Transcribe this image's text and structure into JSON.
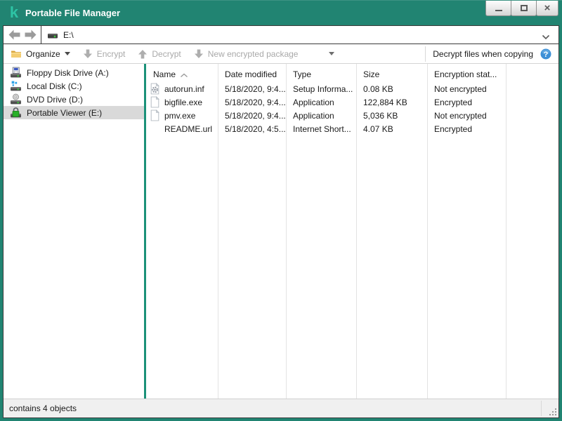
{
  "window": {
    "title": "Portable File Manager",
    "logo_glyph": "k",
    "controls": {
      "minimize": "minimize",
      "maximize": "maximize",
      "close_glyph": "×"
    }
  },
  "colors": {
    "titlebar": "#218472",
    "logo_green": "#2ec4a5",
    "pane_separator": "#1b9179",
    "selection_gray": "#d9d9d9",
    "help_blue": "#3d8fd6",
    "disabled_text": "#a9a9a9"
  },
  "nav": {
    "address": "E:\\",
    "drive_icon": "drive-small-icon",
    "back_icon": "nav-back-icon",
    "forward_icon": "nav-forward-icon"
  },
  "toolbar": {
    "items": [
      {
        "label": "Organize",
        "icon": "folder-icon",
        "enabled": true,
        "has_dropdown": true
      },
      {
        "label": "Encrypt",
        "icon": "arrow-down-icon",
        "enabled": false,
        "has_dropdown": false
      },
      {
        "label": "Decrypt",
        "icon": "arrow-up-icon",
        "enabled": false,
        "has_dropdown": false
      },
      {
        "label": "New encrypted package",
        "icon": "arrow-down-icon",
        "enabled": false,
        "has_dropdown": true
      }
    ],
    "right_label": "Decrypt files when copying",
    "help_icon": "help-icon"
  },
  "sidebar": {
    "items": [
      {
        "label": "Floppy Disk Drive (A:)",
        "icon": "floppy-drive-icon",
        "selected": false
      },
      {
        "label": "Local Disk (C:)",
        "icon": "local-disk-icon",
        "selected": false
      },
      {
        "label": "DVD Drive (D:)",
        "icon": "dvd-drive-icon",
        "selected": false
      },
      {
        "label": "Portable Viewer (E:)",
        "icon": "locked-drive-icon",
        "selected": true
      }
    ]
  },
  "filelist": {
    "columns": [
      "Name",
      "Date modified",
      "Type",
      "Size",
      "Encryption stat..."
    ],
    "sorted_by": "Name",
    "sort_direction": "ascending",
    "rows": [
      {
        "name": "autorun.inf",
        "date": "5/18/2020, 9:4...",
        "type": "Setup Informa...",
        "size": "0.08 KB",
        "status": "Not encrypted",
        "icon": "setup-file-icon"
      },
      {
        "name": "bigfile.exe",
        "date": "5/18/2020, 9:4...",
        "type": "Application",
        "size": "122,884 KB",
        "status": "Encrypted",
        "icon": "file-icon"
      },
      {
        "name": "pmv.exe",
        "date": "5/18/2020, 9:4...",
        "type": "Application",
        "size": "5,036 KB",
        "status": "Not encrypted",
        "icon": "file-icon"
      },
      {
        "name": "README.url",
        "date": "5/18/2020, 4:5...",
        "type": "Internet Short...",
        "size": "4.07 KB",
        "status": "Encrypted",
        "icon": "blank-icon"
      }
    ]
  },
  "statusbar": {
    "text": "contains 4 objects"
  }
}
